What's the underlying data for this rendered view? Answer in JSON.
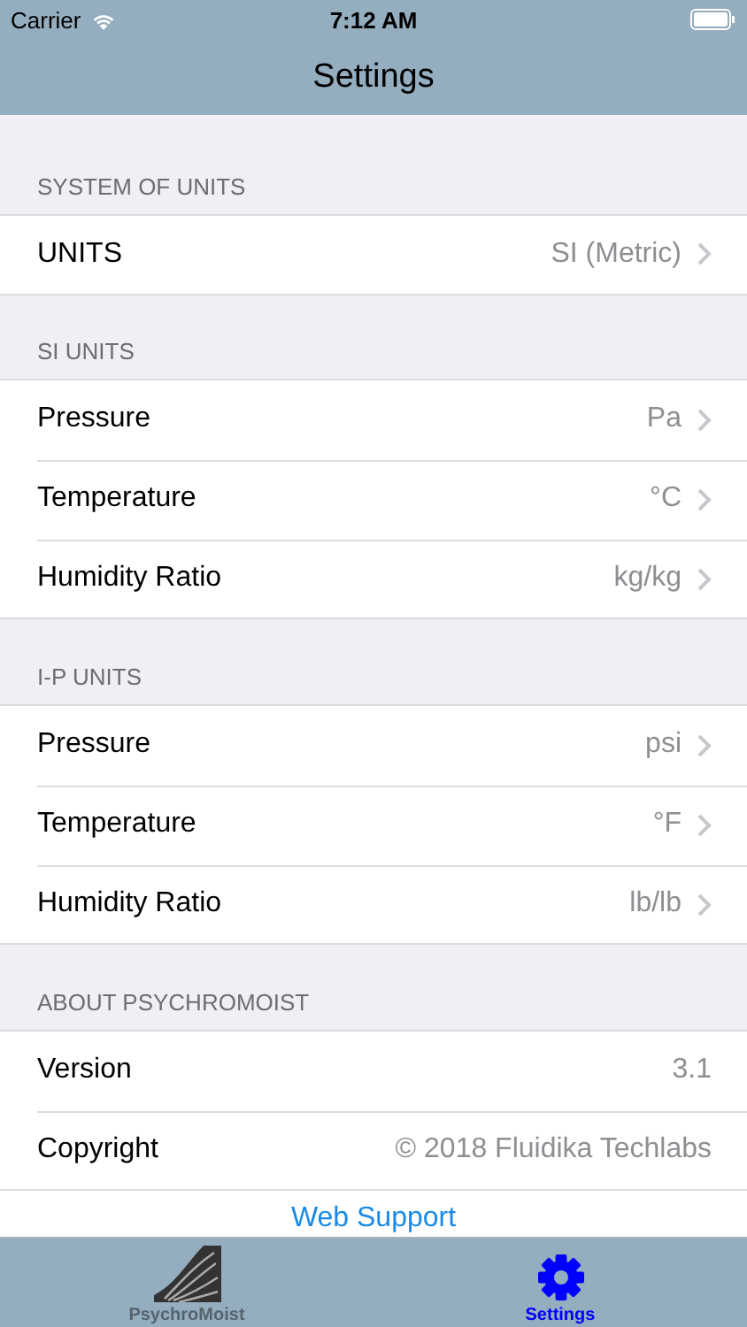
{
  "status_bar": {
    "carrier": "Carrier",
    "time": "7:12 AM"
  },
  "nav": {
    "title": "Settings"
  },
  "sections": [
    {
      "header": "SYSTEM OF UNITS",
      "rows": [
        {
          "kind": "disclosure",
          "label": "UNITS",
          "value": "SI (Metric)"
        }
      ]
    },
    {
      "header": "SI UNITS",
      "rows": [
        {
          "kind": "disclosure",
          "label": "Pressure",
          "value": "Pa"
        },
        {
          "kind": "disclosure",
          "label": "Temperature",
          "value": "°C"
        },
        {
          "kind": "disclosure",
          "label": "Humidity Ratio",
          "value": "kg/kg"
        }
      ]
    },
    {
      "header": "I-P UNITS",
      "rows": [
        {
          "kind": "disclosure",
          "label": "Pressure",
          "value": "psi"
        },
        {
          "kind": "disclosure",
          "label": "Temperature",
          "value": "°F"
        },
        {
          "kind": "disclosure",
          "label": "Humidity Ratio",
          "value": "lb/lb"
        }
      ]
    },
    {
      "header": "ABOUT PSYCHROMOIST",
      "rows": [
        {
          "kind": "info",
          "label": "Version",
          "value": "3.1"
        },
        {
          "kind": "info",
          "label": "Copyright",
          "value": "© 2018 Fluidika Techlabs"
        }
      ]
    }
  ],
  "link": "Web Support",
  "tabs": [
    {
      "label": "PsychroMoist",
      "selected": false
    },
    {
      "label": "Settings",
      "selected": true
    }
  ]
}
